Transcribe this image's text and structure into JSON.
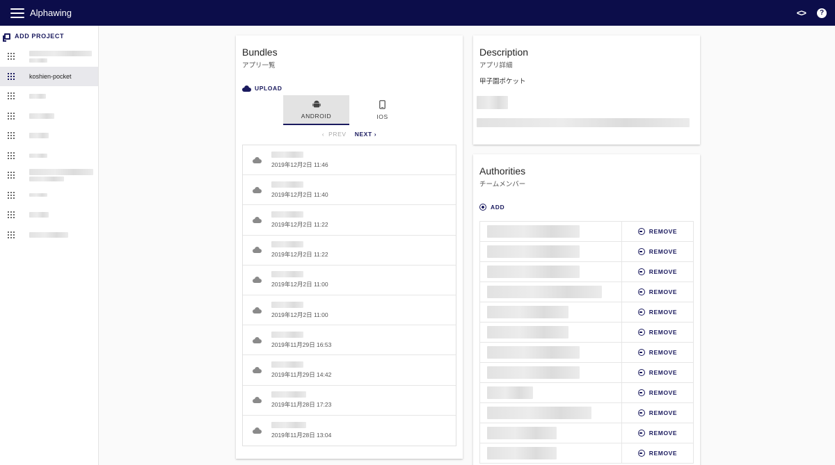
{
  "app": {
    "title": "Alphawing",
    "code_icon": "<>",
    "help_icon": "?"
  },
  "sidebar": {
    "add_project_label": "ADD PROJECT",
    "active_project": "koshien-pocket"
  },
  "bundles": {
    "title": "Bundles",
    "subtitle": "アプリ一覧",
    "upload_label": "UPLOAD",
    "tabs": [
      {
        "label": "ANDROID",
        "icon": "android-icon"
      },
      {
        "label": "IOS",
        "icon": "phone-icon"
      }
    ],
    "pager": {
      "prev": "PREV",
      "next": "NEXT"
    },
    "items": [
      {
        "date": "2019年12月2日 11:46"
      },
      {
        "date": "2019年12月2日 11:40"
      },
      {
        "date": "2019年12月2日 11:22"
      },
      {
        "date": "2019年12月2日 11:22"
      },
      {
        "date": "2019年12月2日 11:00"
      },
      {
        "date": "2019年12月2日 11:00"
      },
      {
        "date": "2019年11月29日 16:53"
      },
      {
        "date": "2019年11月29日 14:42"
      },
      {
        "date": "2019年11月28日 17:23"
      },
      {
        "date": "2019年11月28日 13:04"
      }
    ]
  },
  "description": {
    "title": "Description",
    "subtitle": "アプリ詳細",
    "text": "甲子園ポケット"
  },
  "authorities": {
    "title": "Authorities",
    "subtitle": "チームメンバー",
    "add_label": "ADD",
    "remove_label": "REMOVE"
  },
  "colors": {
    "topbar": "#0c0d4a",
    "accent": "#1a1a5e",
    "active_bg": "#e8e8ec"
  }
}
